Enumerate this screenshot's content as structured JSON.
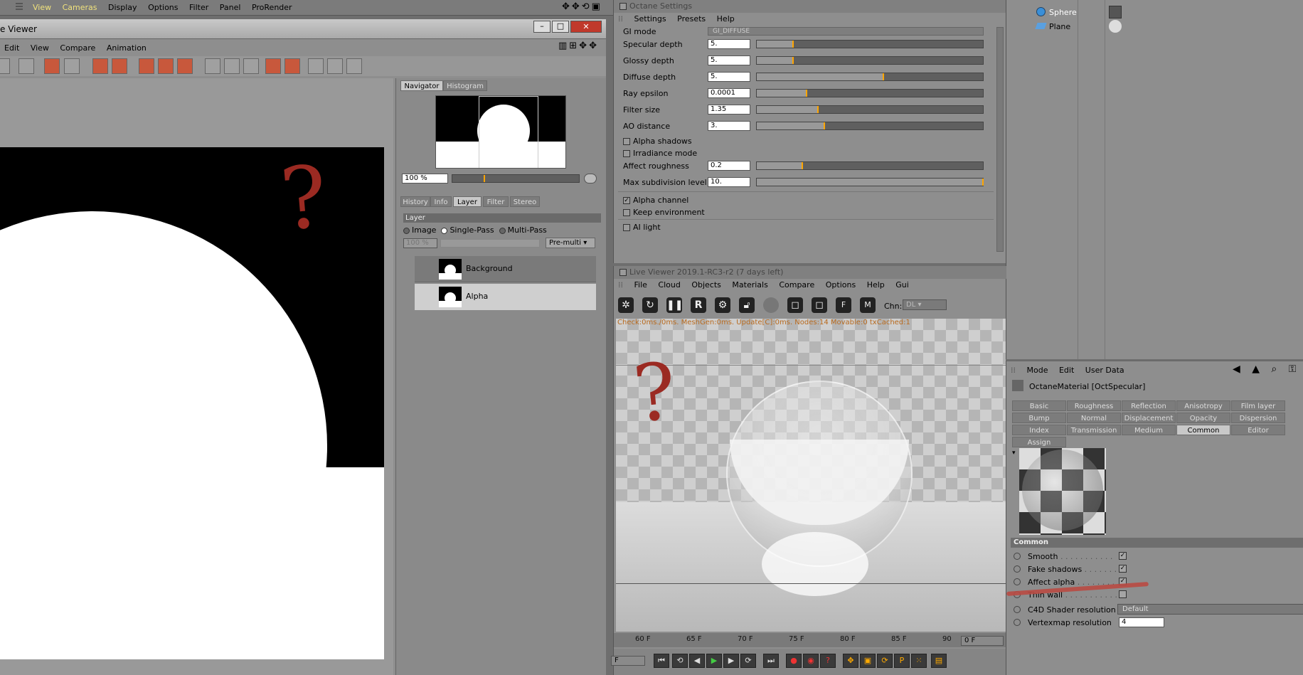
{
  "top_menu": {
    "items": [
      "View",
      "Cameras",
      "Display",
      "Options",
      "Filter",
      "Panel",
      "ProRender"
    ]
  },
  "picture_viewer": {
    "title": "e Viewer",
    "menu": [
      "Edit",
      "View",
      "Compare",
      "Animation"
    ],
    "navigator_tabs": [
      "Navigator",
      "Histogram"
    ],
    "zoom_value": "100 %",
    "info_tabs": [
      "History",
      "Info",
      "Layer",
      "Filter",
      "Stereo"
    ],
    "layer_header": "Layer",
    "mode_options": [
      "Image",
      "Single-Pass",
      "Multi-Pass"
    ],
    "opacity_value": "100 %",
    "blend_mode": "Pre-multi",
    "layers": [
      {
        "name": "Background"
      },
      {
        "name": "Alpha"
      }
    ],
    "annotation": "?"
  },
  "octane_settings": {
    "title": "Octane Settings",
    "menu": [
      "Settings",
      "Presets",
      "Help"
    ],
    "gi_mode_label": "GI mode",
    "gi_mode_value": "GI_DIFFUSE",
    "params": [
      {
        "label": "Specular depth",
        "value": "5.",
        "level": 0.16
      },
      {
        "label": "Glossy depth",
        "value": "5.",
        "level": 0.16
      },
      {
        "label": "Diffuse depth",
        "value": "5.",
        "level": 0.56
      },
      {
        "label": "Ray epsilon",
        "value": "0.0001",
        "level": 0.22
      },
      {
        "label": "Filter size",
        "value": "1.35",
        "level": 0.27
      },
      {
        "label": "AO distance",
        "value": "3.",
        "level": 0.3
      }
    ],
    "checks1": [
      {
        "label": "Alpha shadows",
        "checked": false
      },
      {
        "label": "Irradiance mode",
        "checked": false
      }
    ],
    "params2": [
      {
        "label": "Affect roughness",
        "value": "0.2",
        "level": 0.2
      },
      {
        "label": "Max subdivision level",
        "value": "10.",
        "level": 1.0
      }
    ],
    "checks2": [
      {
        "label": "Alpha channel",
        "checked": true
      },
      {
        "label": "Keep environment",
        "checked": false
      }
    ],
    "checks3": [
      {
        "label": "AI light",
        "checked": false
      }
    ]
  },
  "live_viewer": {
    "title": "Live Viewer 2019.1-RC3-r2 (7 days left)",
    "menu": [
      "File",
      "Cloud",
      "Objects",
      "Materials",
      "Compare",
      "Options",
      "Help",
      "Gui"
    ],
    "chn_label": "Chn:",
    "chn_value": "DL",
    "status": "Check:0ms./0ms. MeshGen:0ms. Update[C]:0ms. Nodes:14 Movable:0 txCached:1",
    "annotation": "?"
  },
  "object_manager": {
    "objects": [
      {
        "name": "Sphere"
      },
      {
        "name": "Plane"
      }
    ]
  },
  "attributes": {
    "menu": [
      "Mode",
      "Edit",
      "User Data"
    ],
    "material_title": "OctaneMaterial [OctSpecular]",
    "tabs": [
      [
        "Basic",
        "Roughness",
        "Reflection",
        "Anisotropy",
        "Film layer"
      ],
      [
        "Bump",
        "Normal",
        "Displacement",
        "Opacity",
        "Dispersion"
      ],
      [
        "Index",
        "Transmission",
        "Medium",
        "Common",
        "Editor"
      ],
      [
        "Assign"
      ]
    ],
    "active_tab": "Common",
    "section": "Common",
    "options": [
      {
        "label": "Smooth",
        "dots": " . . . . . . . . . . .",
        "checked": true
      },
      {
        "label": "Fake shadows",
        "dots": " . . . . . . .",
        "checked": true
      },
      {
        "label": "Affect alpha",
        "dots": " . . . . . . . .",
        "checked": true
      },
      {
        "label": "Thin wall",
        "dots": " . . . . . . . . . . .",
        "checked": false
      }
    ],
    "shader_res_label": "C4D Shader resolution",
    "shader_res_value": "Default",
    "vertex_res_label": "Vertexmap resolution",
    "vertex_res_value": "4"
  },
  "timeline": {
    "ticks": [
      "60 F",
      "65 F",
      "70 F",
      "75 F",
      "80 F",
      "85 F",
      "90"
    ],
    "frame_end": "0 F",
    "frame_start": "F"
  },
  "colors": {
    "annotation_red": "#9b2a22",
    "accent": "#ffa500",
    "panel": "#8e8e8e"
  }
}
